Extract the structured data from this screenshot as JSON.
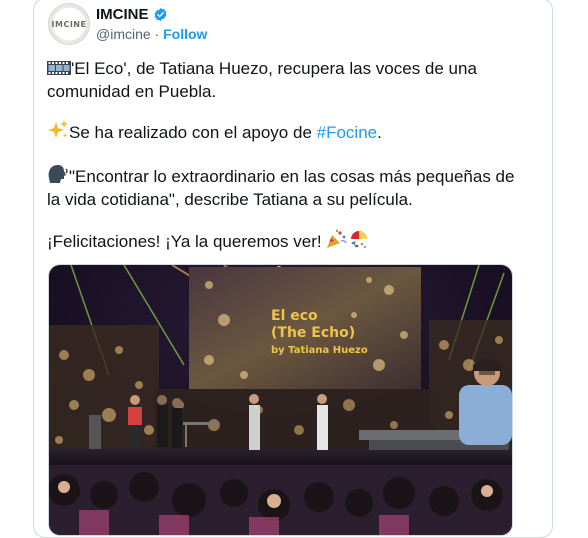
{
  "account": {
    "name": "IMCINE",
    "avatar_text": "IMCINE",
    "handle": "@imcine",
    "separator": " · ",
    "follow_label": "Follow"
  },
  "tweet": {
    "line1_text": "'El Eco', de Tatiana Huezo, recupera las voces de una comunidad en Puebla.",
    "line2_prefix": "Se ha realizado con el apoyo de ",
    "line2_hashtag": "#Focine",
    "line2_suffix": ".",
    "line3_text": "\"Encontrar lo extraordinario en las cosas más pequeñas de la vida cotidiana\", describe Tatiana a su película.",
    "line4_text": "¡Felicitaciones! ¡Ya la queremos ver! ",
    "emoji_icons": [
      "film-frames-icon",
      "sparkles-icon",
      "speaking-head-icon",
      "party-popper-icon",
      "confetti-ball-icon"
    ]
  },
  "media": {
    "screen_line1": "El eco",
    "screen_line2": "(The Echo)",
    "screen_line3": "by Tatiana Huezo"
  },
  "colors": {
    "link": "#1d9bf0",
    "verified": "#1d9bf0",
    "secondary_text": "#536471",
    "border": "#cfd9de"
  }
}
